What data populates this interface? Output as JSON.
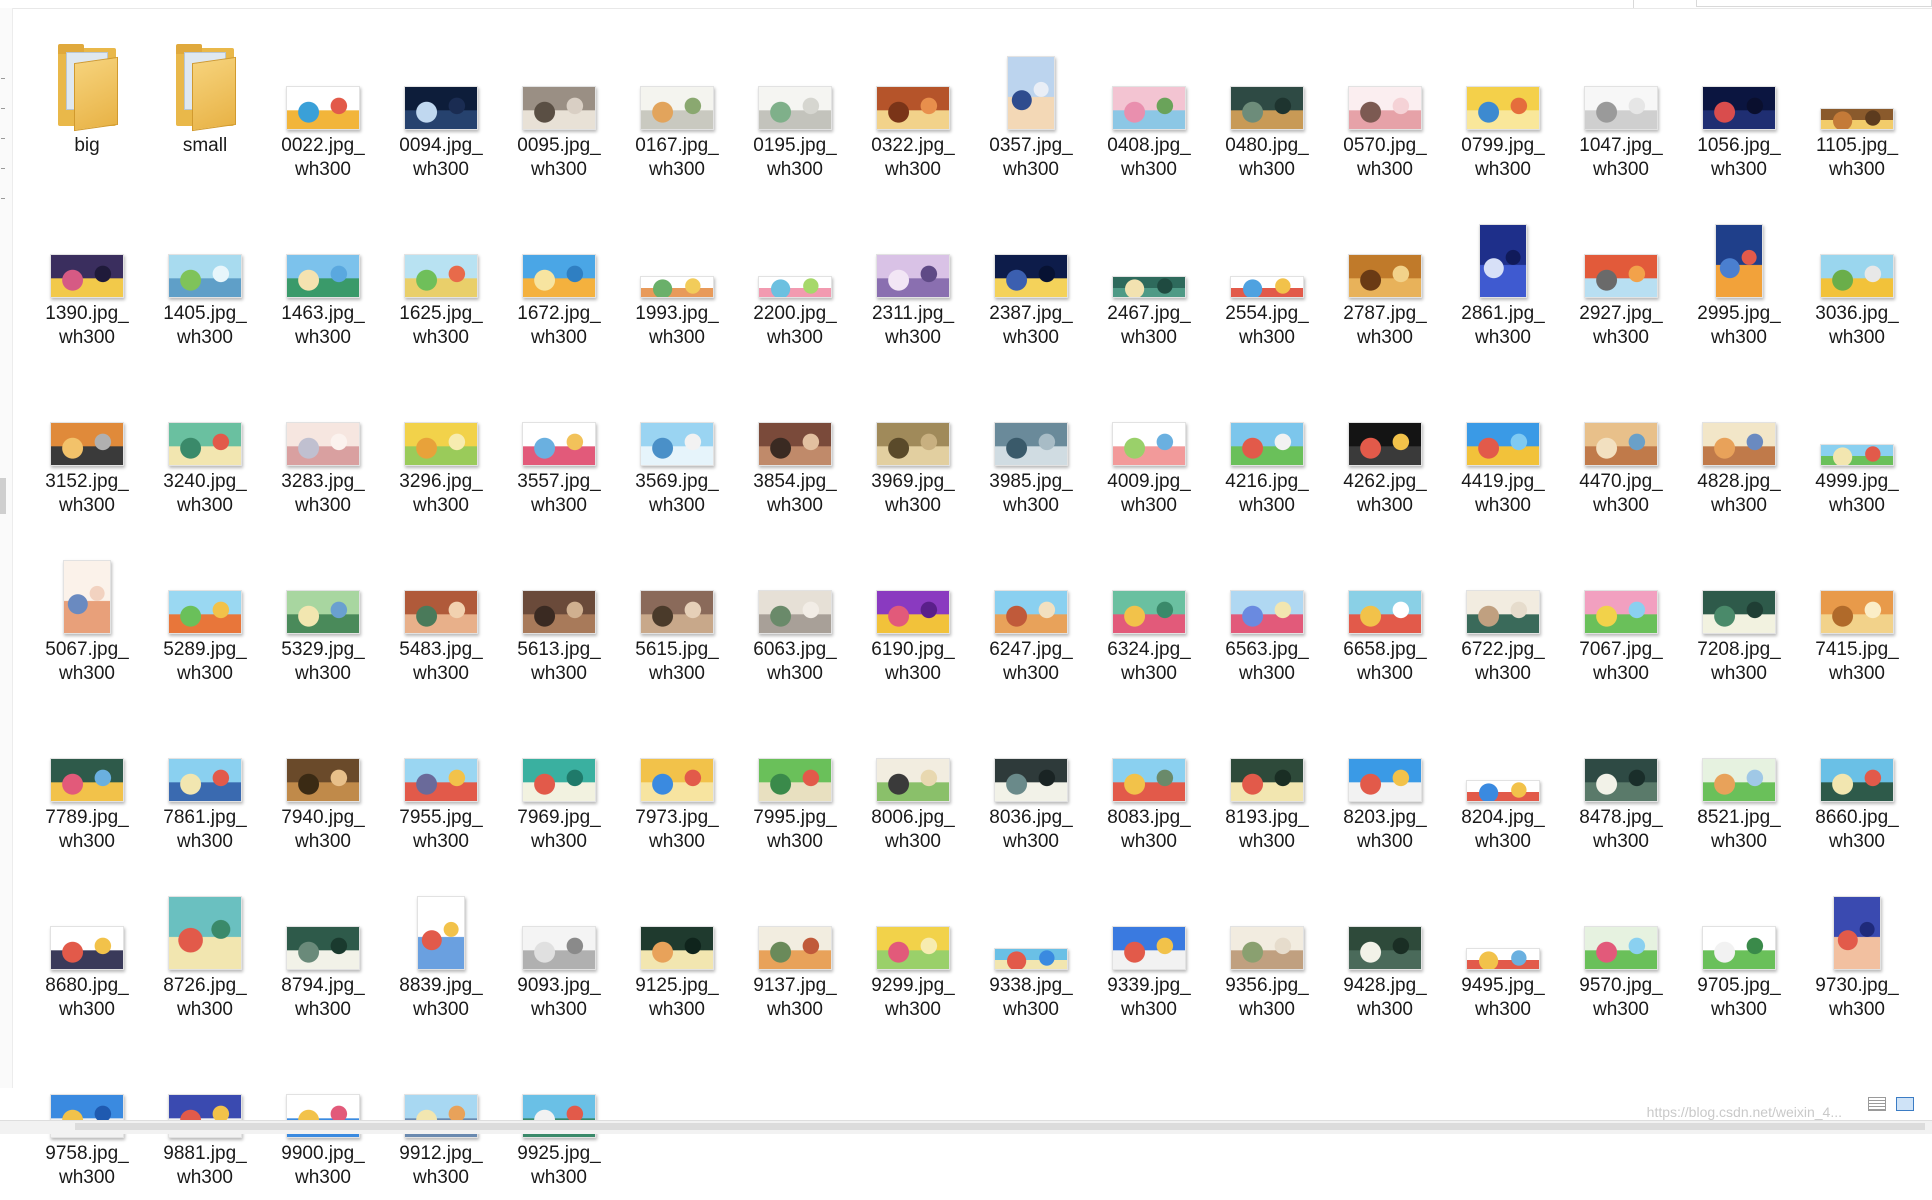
{
  "items": [
    {
      "label": "big",
      "type": "folder"
    },
    {
      "label": "small",
      "type": "folder"
    },
    {
      "label": "0022.jpg_\nwh300",
      "type": "image",
      "shape": "wide",
      "colors": [
        "#ffffff",
        "#f2b53a",
        "#3aa0d8",
        "#e25a4a"
      ]
    },
    {
      "label": "0094.jpg_\nwh300",
      "type": "image",
      "shape": "wide",
      "colors": [
        "#0d1d3a",
        "#26426e",
        "#c0d8f0",
        "#1a2c52"
      ]
    },
    {
      "label": "0095.jpg_\nwh300",
      "type": "image",
      "shape": "wide",
      "colors": [
        "#9a8f84",
        "#e8e1d6",
        "#5a4f44",
        "#d9cfc4"
      ]
    },
    {
      "label": "0167.jpg_\nwh300",
      "type": "image",
      "shape": "wide",
      "colors": [
        "#f4f4ef",
        "#c9c9c0",
        "#e2a45c",
        "#8aa870"
      ]
    },
    {
      "label": "0195.jpg_\nwh300",
      "type": "image",
      "shape": "wide",
      "colors": [
        "#f5f5f2",
        "#c3c3bc",
        "#7fb08a",
        "#d6d6d0"
      ]
    },
    {
      "label": "0322.jpg_\nwh300",
      "type": "image",
      "shape": "wide",
      "colors": [
        "#b5542a",
        "#f2d28a",
        "#7a3418",
        "#e88f4c"
      ]
    },
    {
      "label": "0357.jpg_\nwh300",
      "type": "image",
      "shape": "tall",
      "colors": [
        "#bcd4ee",
        "#f3d8b6",
        "#2f4c8e",
        "#e9eef6"
      ]
    },
    {
      "label": "0408.jpg_\nwh300",
      "type": "image",
      "shape": "wide",
      "colors": [
        "#f3c4d2",
        "#8cc7e5",
        "#e98fae",
        "#6aa35a"
      ]
    },
    {
      "label": "0480.jpg_\nwh300",
      "type": "image",
      "shape": "wide",
      "colors": [
        "#2e4a44",
        "#c89a56",
        "#6d8c7a",
        "#1e342f"
      ]
    },
    {
      "label": "0570.jpg_\nwh300",
      "type": "image",
      "shape": "wide",
      "colors": [
        "#fbeef0",
        "#e6a2a8",
        "#7c5a52",
        "#f5d2d6"
      ]
    },
    {
      "label": "0799.jpg_\nwh300",
      "type": "image",
      "shape": "wide",
      "colors": [
        "#f4d04a",
        "#f9e79a",
        "#3d8ad0",
        "#e56d3c"
      ]
    },
    {
      "label": "1047.jpg_\nwh300",
      "type": "image",
      "shape": "wide",
      "colors": [
        "#f7f7f7",
        "#cfcfcf",
        "#9a9a9a",
        "#e6e6e6"
      ]
    },
    {
      "label": "1056.jpg_\nwh300",
      "type": "image",
      "shape": "wide",
      "colors": [
        "#0b1540",
        "#1f2e72",
        "#d94d4d",
        "#0a0f2e"
      ]
    },
    {
      "label": "1105.jpg_\nwh300",
      "type": "image",
      "shape": "strip",
      "colors": [
        "#8a5a2c",
        "#f2cc6a",
        "#c47a38",
        "#5c3b1e"
      ]
    },
    {
      "label": "1390.jpg_\nwh300",
      "type": "image",
      "shape": "wide",
      "colors": [
        "#3a2e5e",
        "#f2c94a",
        "#d65a84",
        "#1f1a3a"
      ]
    },
    {
      "label": "1405.jpg_\nwh300",
      "type": "image",
      "shape": "wide",
      "colors": [
        "#a8dbef",
        "#5f9fc8",
        "#7fc35a",
        "#e8f6fb"
      ]
    },
    {
      "label": "1463.jpg_\nwh300",
      "type": "image",
      "shape": "wide",
      "colors": [
        "#7cc2ec",
        "#3a9a6a",
        "#f5e2b0",
        "#5aa8df"
      ]
    },
    {
      "label": "1625.jpg_\nwh300",
      "type": "image",
      "shape": "wide",
      "colors": [
        "#b8e2f2",
        "#e9cf6a",
        "#6fbf5a",
        "#e86a4a"
      ]
    },
    {
      "label": "1672.jpg_\nwh300",
      "type": "image",
      "shape": "wide",
      "colors": [
        "#4aa6e6",
        "#f4b13e",
        "#f7e4a0",
        "#2f7fc2"
      ]
    },
    {
      "label": "1993.jpg_\nwh300",
      "type": "image",
      "shape": "strip",
      "colors": [
        "#ffffff",
        "#e89a5a",
        "#6ab06a",
        "#f2cc5a"
      ]
    },
    {
      "label": "2200.jpg_\nwh300",
      "type": "image",
      "shape": "strip",
      "colors": [
        "#ffffff",
        "#f29ab0",
        "#6cc0e0",
        "#a6d86a"
      ]
    },
    {
      "label": "2311.jpg_\nwh300",
      "type": "image",
      "shape": "wide",
      "colors": [
        "#d9c2e6",
        "#8a6fb0",
        "#f2e6f5",
        "#5f4a86"
      ]
    },
    {
      "label": "2387.jpg_\nwh300",
      "type": "image",
      "shape": "wide",
      "colors": [
        "#0d1c4a",
        "#f4d25a",
        "#3b5fb0",
        "#071233"
      ]
    },
    {
      "label": "2467.jpg_\nwh300",
      "type": "image",
      "shape": "strip",
      "colors": [
        "#2e6a5c",
        "#4f9a86",
        "#f2e2b0",
        "#1f4a40"
      ]
    },
    {
      "label": "2554.jpg_\nwh300",
      "type": "image",
      "shape": "strip",
      "colors": [
        "#ffffff",
        "#e25a4a",
        "#4fa2e0",
        "#f2c24a"
      ]
    },
    {
      "label": "2787.jpg_\nwh300",
      "type": "image",
      "shape": "wide",
      "colors": [
        "#c07a2a",
        "#e8b25a",
        "#6a3a14",
        "#f2d28a"
      ]
    },
    {
      "label": "2861.jpg_\nwh300",
      "type": "image",
      "shape": "tall",
      "colors": [
        "#1e2f8a",
        "#3f5ad0",
        "#d7e0f7",
        "#101a5a"
      ]
    },
    {
      "label": "2927.jpg_\nwh300",
      "type": "image",
      "shape": "wide",
      "colors": [
        "#e25a3a",
        "#b8dff2",
        "#6a6a6a",
        "#f2a24a"
      ]
    },
    {
      "label": "2995.jpg_\nwh300",
      "type": "image",
      "shape": "tall",
      "colors": [
        "#1f3f8a",
        "#f2a23a",
        "#4a7fd0",
        "#e25a4a"
      ]
    },
    {
      "label": "3036.jpg_\nwh300",
      "type": "image",
      "shape": "wide",
      "colors": [
        "#9ad6ee",
        "#f2c23a",
        "#6aae4a",
        "#e8e8e8"
      ]
    },
    {
      "label": "3152.jpg_\nwh300",
      "type": "image",
      "shape": "wide",
      "colors": [
        "#e08a3a",
        "#3a3a3a",
        "#f2c26a",
        "#b0b0b0"
      ]
    },
    {
      "label": "3240.jpg_\nwh300",
      "type": "image",
      "shape": "wide",
      "colors": [
        "#6ac0a0",
        "#f2e6b0",
        "#3a8a6a",
        "#e25a4a"
      ]
    },
    {
      "label": "3283.jpg_\nwh300",
      "type": "image",
      "shape": "wide",
      "colors": [
        "#f6e6e0",
        "#d9a0a0",
        "#c0c0d0",
        "#fbf2ee"
      ]
    },
    {
      "label": "3296.jpg_\nwh300",
      "type": "image",
      "shape": "wide",
      "colors": [
        "#f2d24a",
        "#9acb5a",
        "#e8a23a",
        "#f7ecb0"
      ]
    },
    {
      "label": "3557.jpg_\nwh300",
      "type": "image",
      "shape": "wide",
      "colors": [
        "#ffffff",
        "#e25a7a",
        "#6ab0e0",
        "#f2c25a"
      ]
    },
    {
      "label": "3569.jpg_\nwh300",
      "type": "image",
      "shape": "wide",
      "colors": [
        "#9ad4f2",
        "#e6f4fb",
        "#4a90c8",
        "#f2f2f2"
      ]
    },
    {
      "label": "3854.jpg_\nwh300",
      "type": "image",
      "shape": "wide",
      "colors": [
        "#7a4a3a",
        "#c08a6a",
        "#3a2a22",
        "#e2c0a0"
      ]
    },
    {
      "label": "3969.jpg_\nwh300",
      "type": "image",
      "shape": "wide",
      "colors": [
        "#a08a5a",
        "#e2cfa0",
        "#5a4a2a",
        "#c8b080"
      ]
    },
    {
      "label": "3985.jpg_\nwh300",
      "type": "image",
      "shape": "wide",
      "colors": [
        "#6a8a9a",
        "#d0dce2",
        "#3a5a6a",
        "#a8bcc6"
      ]
    },
    {
      "label": "4009.jpg_\nwh300",
      "type": "image",
      "shape": "wide",
      "colors": [
        "#ffffff",
        "#f29a9a",
        "#9ad06a",
        "#6ab0e0"
      ]
    },
    {
      "label": "4216.jpg_\nwh300",
      "type": "image",
      "shape": "wide",
      "colors": [
        "#7cc6ec",
        "#6ac05a",
        "#e25a4a",
        "#f2f2f2"
      ]
    },
    {
      "label": "4262.jpg_\nwh300",
      "type": "image",
      "shape": "wide",
      "colors": [
        "#141414",
        "#3a3a3a",
        "#e25a4a",
        "#f2c24a"
      ]
    },
    {
      "label": "4419.jpg_\nwh300",
      "type": "image",
      "shape": "wide",
      "colors": [
        "#3a9ae6",
        "#f2c23a",
        "#e25a4a",
        "#7fcaf2"
      ]
    },
    {
      "label": "4470.jpg_\nwh300",
      "type": "image",
      "shape": "wide",
      "colors": [
        "#e8c08a",
        "#c07a4a",
        "#f2e0c0",
        "#6aa0c8"
      ]
    },
    {
      "label": "4828.jpg_\nwh300",
      "type": "image",
      "shape": "wide",
      "colors": [
        "#f2e6c8",
        "#c07a4a",
        "#e8a25a",
        "#6a8ac0"
      ]
    },
    {
      "label": "4999.jpg_\nwh300",
      "type": "image",
      "shape": "strip",
      "colors": [
        "#8ad0f0",
        "#6ac05a",
        "#f2e6b0",
        "#e25a4a"
      ]
    },
    {
      "label": "5067.jpg_\nwh300",
      "type": "image",
      "shape": "tall",
      "colors": [
        "#fbf2ea",
        "#e8a07a",
        "#6a8ac0",
        "#f2d2c0"
      ]
    },
    {
      "label": "5289.jpg_\nwh300",
      "type": "image",
      "shape": "wide",
      "colors": [
        "#9ad8f2",
        "#e8763a",
        "#6ac05a",
        "#f2c24a"
      ]
    },
    {
      "label": "5329.jpg_\nwh300",
      "type": "image",
      "shape": "wide",
      "colors": [
        "#a8d6a0",
        "#4a8a5a",
        "#f2e6b0",
        "#6aa0d0"
      ]
    },
    {
      "label": "5483.jpg_\nwh300",
      "type": "image",
      "shape": "wide",
      "colors": [
        "#b05a3a",
        "#e8b08a",
        "#4a7a5a",
        "#f2d2b0"
      ]
    },
    {
      "label": "5613.jpg_\nwh300",
      "type": "image",
      "shape": "wide",
      "colors": [
        "#6a4a3a",
        "#a87a5a",
        "#3a2a22",
        "#d0b090"
      ]
    },
    {
      "label": "5615.jpg_\nwh300",
      "type": "image",
      "shape": "wide",
      "colors": [
        "#8a6a5a",
        "#c8a88a",
        "#4a3a2a",
        "#e6d0b8"
      ]
    },
    {
      "label": "6063.jpg_\nwh300",
      "type": "image",
      "shape": "wide",
      "colors": [
        "#e6e0d6",
        "#a8a098",
        "#6a8a6a",
        "#f2ede6"
      ]
    },
    {
      "label": "6190.jpg_\nwh300",
      "type": "image",
      "shape": "wide",
      "colors": [
        "#8a3ac0",
        "#f2c23a",
        "#e25a7a",
        "#5a1f8a"
      ]
    },
    {
      "label": "6247.jpg_\nwh300",
      "type": "image",
      "shape": "wide",
      "colors": [
        "#8ad0f0",
        "#e8a25a",
        "#c05a3a",
        "#f2e0c0"
      ]
    },
    {
      "label": "6324.jpg_\nwh300",
      "type": "image",
      "shape": "wide",
      "colors": [
        "#6ac0a0",
        "#e25a7a",
        "#f2c24a",
        "#3a8a6a"
      ]
    },
    {
      "label": "6563.jpg_\nwh300",
      "type": "image",
      "shape": "wide",
      "colors": [
        "#b0d8f2",
        "#e25a7a",
        "#6a8ae0",
        "#f2e6b0"
      ]
    },
    {
      "label": "6658.jpg_\nwh300",
      "type": "image",
      "shape": "wide",
      "colors": [
        "#8ad0e6",
        "#e25a4a",
        "#f2c24a",
        "#ffffff"
      ]
    },
    {
      "label": "6722.jpg_\nwh300",
      "type": "image",
      "shape": "wide",
      "colors": [
        "#f2ece0",
        "#3a6a5a",
        "#c0a080",
        "#e6dccc"
      ]
    },
    {
      "label": "7067.jpg_\nwh300",
      "type": "image",
      "shape": "wide",
      "colors": [
        "#f2a0c0",
        "#6ac05a",
        "#f2d24a",
        "#8ad0f0"
      ]
    },
    {
      "label": "7208.jpg_\nwh300",
      "type": "image",
      "shape": "wide",
      "colors": [
        "#2e5a4a",
        "#f2f2e0",
        "#4a8a6a",
        "#1f3e34"
      ]
    },
    {
      "label": "7415.jpg_\nwh300",
      "type": "image",
      "shape": "wide",
      "colors": [
        "#e89a4a",
        "#f2d28a",
        "#b06a2a",
        "#fbeec8"
      ]
    },
    {
      "label": "7789.jpg_\nwh300",
      "type": "image",
      "shape": "wide",
      "colors": [
        "#2e5a4a",
        "#f2c24a",
        "#e25a7a",
        "#6ab0e0"
      ]
    },
    {
      "label": "7861.jpg_\nwh300",
      "type": "image",
      "shape": "wide",
      "colors": [
        "#8ad0f0",
        "#3a6ab0",
        "#f2e6b0",
        "#e25a4a"
      ]
    },
    {
      "label": "7940.jpg_\nwh300",
      "type": "image",
      "shape": "wide",
      "colors": [
        "#6a4a2a",
        "#c08a4a",
        "#3a2a14",
        "#e8c08a"
      ]
    },
    {
      "label": "7955.jpg_\nwh300",
      "type": "image",
      "shape": "wide",
      "colors": [
        "#9ad6f2",
        "#e25a4a",
        "#6a6a9a",
        "#f2c24a"
      ]
    },
    {
      "label": "7969.jpg_\nwh300",
      "type": "image",
      "shape": "wide",
      "colors": [
        "#3ab0a0",
        "#f2f2e0",
        "#e25a4a",
        "#1f7a6a"
      ]
    },
    {
      "label": "7973.jpg_\nwh300",
      "type": "image",
      "shape": "wide",
      "colors": [
        "#f2c24a",
        "#f7e4a0",
        "#3a8ae0",
        "#e25a4a"
      ]
    },
    {
      "label": "7995.jpg_\nwh300",
      "type": "image",
      "shape": "wide",
      "colors": [
        "#6ac05a",
        "#e8e0c0",
        "#3a8a4a",
        "#e25a4a"
      ]
    },
    {
      "label": "8006.jpg_\nwh300",
      "type": "image",
      "shape": "wide",
      "colors": [
        "#f2ede0",
        "#8ac06a",
        "#3a3a3a",
        "#e8d8b0"
      ]
    },
    {
      "label": "8036.jpg_\nwh300",
      "type": "image",
      "shape": "wide",
      "colors": [
        "#2e3a3a",
        "#f2f2e8",
        "#6a8a8a",
        "#1a2424"
      ]
    },
    {
      "label": "8083.jpg_\nwh300",
      "type": "image",
      "shape": "wide",
      "colors": [
        "#8ad0f0",
        "#e25a4a",
        "#f2c24a",
        "#6a8a6a"
      ]
    },
    {
      "label": "8193.jpg_\nwh300",
      "type": "image",
      "shape": "wide",
      "colors": [
        "#2e4a3a",
        "#f2e6b0",
        "#e25a4a",
        "#1a2e24"
      ]
    },
    {
      "label": "8203.jpg_\nwh300",
      "type": "image",
      "shape": "wide",
      "colors": [
        "#3a9ae6",
        "#f2f2f2",
        "#e25a4a",
        "#f2c24a"
      ]
    },
    {
      "label": "8204.jpg_\nwh300",
      "type": "image",
      "shape": "strip",
      "colors": [
        "#ffffff",
        "#e25a4a",
        "#3a8ae0",
        "#f2c24a"
      ]
    },
    {
      "label": "8478.jpg_\nwh300",
      "type": "image",
      "shape": "wide",
      "colors": [
        "#2e4a44",
        "#5a7a6a",
        "#f2f2e8",
        "#1a2e2a"
      ]
    },
    {
      "label": "8521.jpg_\nwh300",
      "type": "image",
      "shape": "wide",
      "colors": [
        "#e6f2e0",
        "#6ac05a",
        "#e8a25a",
        "#a0c8e6"
      ]
    },
    {
      "label": "8660.jpg_\nwh300",
      "type": "image",
      "shape": "wide",
      "colors": [
        "#6ac0e6",
        "#2e5a4a",
        "#f2e6b0",
        "#e25a4a"
      ]
    },
    {
      "label": "8680.jpg_\nwh300",
      "type": "image",
      "shape": "wide",
      "colors": [
        "#ffffff",
        "#3a3a5a",
        "#e25a4a",
        "#f2c24a"
      ]
    },
    {
      "label": "8726.jpg_\nwh300",
      "type": "image",
      "shape": "square",
      "colors": [
        "#6ac0c0",
        "#f2e6b0",
        "#e25a4a",
        "#3a8a6a"
      ]
    },
    {
      "label": "8794.jpg_\nwh300",
      "type": "image",
      "shape": "wide",
      "colors": [
        "#2e5a4a",
        "#f2f2e8",
        "#6a8a7a",
        "#1a3a2e"
      ]
    },
    {
      "label": "8839.jpg_\nwh300",
      "type": "image",
      "shape": "tall",
      "colors": [
        "#ffffff",
        "#6aa0e0",
        "#e25a4a",
        "#f2c24a"
      ]
    },
    {
      "label": "9093.jpg_\nwh300",
      "type": "image",
      "shape": "wide",
      "colors": [
        "#f4f4f4",
        "#b0b0b0",
        "#e0e0e0",
        "#8a8a8a"
      ]
    },
    {
      "label": "9125.jpg_\nwh300",
      "type": "image",
      "shape": "wide",
      "colors": [
        "#1f3a2e",
        "#f2e6b0",
        "#e8a25a",
        "#0f241c"
      ]
    },
    {
      "label": "9137.jpg_\nwh300",
      "type": "image",
      "shape": "wide",
      "colors": [
        "#f2ede0",
        "#e8a25a",
        "#6a8a5a",
        "#c05a3a"
      ]
    },
    {
      "label": "9299.jpg_\nwh300",
      "type": "image",
      "shape": "wide",
      "colors": [
        "#f2d24a",
        "#9ad06a",
        "#e25a7a",
        "#f7ecb0"
      ]
    },
    {
      "label": "9338.jpg_\nwh300",
      "type": "image",
      "shape": "strip",
      "colors": [
        "#6ac0e6",
        "#f2e6b0",
        "#e25a4a",
        "#3a8ae0"
      ]
    },
    {
      "label": "9339.jpg_\nwh300",
      "type": "image",
      "shape": "wide",
      "colors": [
        "#3a7ae0",
        "#f2f2f2",
        "#e25a4a",
        "#f2c24a"
      ]
    },
    {
      "label": "9356.jpg_\nwh300",
      "type": "image",
      "shape": "wide",
      "colors": [
        "#f2ece0",
        "#c0a080",
        "#8aa070",
        "#e6dccc"
      ]
    },
    {
      "label": "9428.jpg_\nwh300",
      "type": "image",
      "shape": "wide",
      "colors": [
        "#2e4a3a",
        "#4a6a5a",
        "#f2f2e8",
        "#1a2e24"
      ]
    },
    {
      "label": "9495.jpg_\nwh300",
      "type": "image",
      "shape": "strip",
      "colors": [
        "#ffffff",
        "#e25a4a",
        "#f2c24a",
        "#6ab0e0"
      ]
    },
    {
      "label": "9570.jpg_\nwh300",
      "type": "image",
      "shape": "wide",
      "colors": [
        "#e6f2e0",
        "#6ac05a",
        "#e25a7a",
        "#8ad0f0"
      ]
    },
    {
      "label": "9705.jpg_\nwh300",
      "type": "image",
      "shape": "wide",
      "colors": [
        "#ffffff",
        "#6ac05a",
        "#f2f2f2",
        "#3a8a4a"
      ]
    },
    {
      "label": "9730.jpg_\nwh300",
      "type": "image",
      "shape": "tall",
      "colors": [
        "#3a4ab0",
        "#f2c0a0",
        "#e25a4a",
        "#1f2a7a"
      ]
    },
    {
      "label": "9758.jpg_\nwh300",
      "type": "image",
      "shape": "wide",
      "colors": [
        "#3a8ae0",
        "#f2f2f2",
        "#f2c24a",
        "#1f5ab0"
      ]
    },
    {
      "label": "9881.jpg_\nwh300",
      "type": "image",
      "shape": "wide",
      "colors": [
        "#3a4ab0",
        "#f2f2f2",
        "#e25a4a",
        "#f2c24a"
      ]
    },
    {
      "label": "9900.jpg_\nwh300",
      "type": "image",
      "shape": "wide",
      "colors": [
        "#ffffff",
        "#3a8ae0",
        "#f2c24a",
        "#e25a7a"
      ]
    },
    {
      "label": "9912.jpg_\nwh300",
      "type": "image",
      "shape": "wide",
      "colors": [
        "#a8d8f2",
        "#6a8ab0",
        "#f2e6b0",
        "#e8a25a"
      ]
    },
    {
      "label": "9925.jpg_\nwh300",
      "type": "image",
      "shape": "wide",
      "colors": [
        "#6ac0e6",
        "#3a8a6a",
        "#f2f2f2",
        "#e25a4a"
      ]
    }
  ],
  "watermark": "https://blog.csdn.net/weixin_4..."
}
